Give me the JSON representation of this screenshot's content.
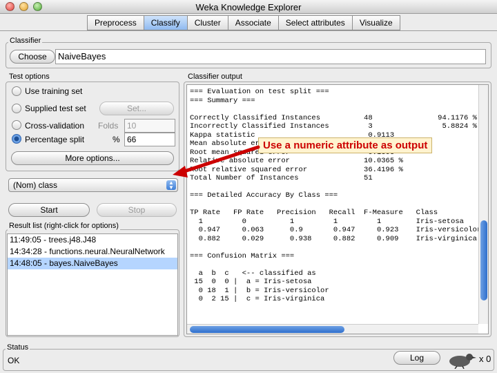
{
  "window": {
    "title": "Weka Knowledge Explorer"
  },
  "tabs": [
    {
      "label": "Preprocess",
      "active": false
    },
    {
      "label": "Classify",
      "active": true
    },
    {
      "label": "Cluster",
      "active": false
    },
    {
      "label": "Associate",
      "active": false
    },
    {
      "label": "Select attributes",
      "active": false
    },
    {
      "label": "Visualize",
      "active": false
    }
  ],
  "classifier": {
    "group_label": "Classifier",
    "choose_label": "Choose",
    "name": "NaiveBayes"
  },
  "test_options": {
    "group_label": "Test options",
    "use_training_set": "Use training set",
    "supplied_test_set": "Supplied test set",
    "set_button": "Set...",
    "cross_validation": "Cross-validation",
    "folds_label": "Folds",
    "folds_value": "10",
    "percentage_split": "Percentage split",
    "percent_symbol": "%",
    "percentage_value": "66",
    "more_options": "More options...",
    "selected": "percentage_split"
  },
  "class_select": {
    "value": "(Nom) class"
  },
  "actions": {
    "start": "Start",
    "stop": "Stop"
  },
  "result_list": {
    "group_label": "Result list (right-click for options)",
    "items": [
      "11:49:05 - trees.j48.J48",
      "14:34:28 - functions.neural.NeuralNetwork",
      "14:48:05 - bayes.NaiveBayes"
    ],
    "selected_index": 2
  },
  "output": {
    "group_label": "Classifier output",
    "text": "=== Evaluation on test split ===\n=== Summary ===\n\nCorrectly Classified Instances          48               94.1176 %\nIncorrectly Classified Instances         3                5.8824 %\nKappa statistic                          0.9113\nMean absolute error                      0.0407\nRoot mean squared error                  0.1606\nRelative absolute error                 10.0365 %\nRoot relative squared error             36.4196 %\nTotal Number of Instances               51\n\n=== Detailed Accuracy By Class ===\n\nTP Rate   FP Rate   Precision   Recall  F-Measure   Class\n  1         0          1         1         1        Iris-setosa\n  0.947     0.063      0.9       0.947     0.923    Iris-versicolor\n  0.882     0.029      0.938     0.882     0.909    Iris-virginica\n\n=== Confusion Matrix ===\n\n  a  b  c   <-- classified as\n 15  0  0 |  a = Iris-setosa\n  0 18  1 |  b = Iris-versicolor\n  0  2 15 |  c = Iris-virginica",
    "vscroll_position": 0.55,
    "hscroll_fraction": 0.55
  },
  "annotation": {
    "text": "Use a numeric attribute as output",
    "color": "#cc0000"
  },
  "status": {
    "group_label": "Status",
    "text": "OK",
    "log_button": "Log",
    "count": "x 0"
  }
}
